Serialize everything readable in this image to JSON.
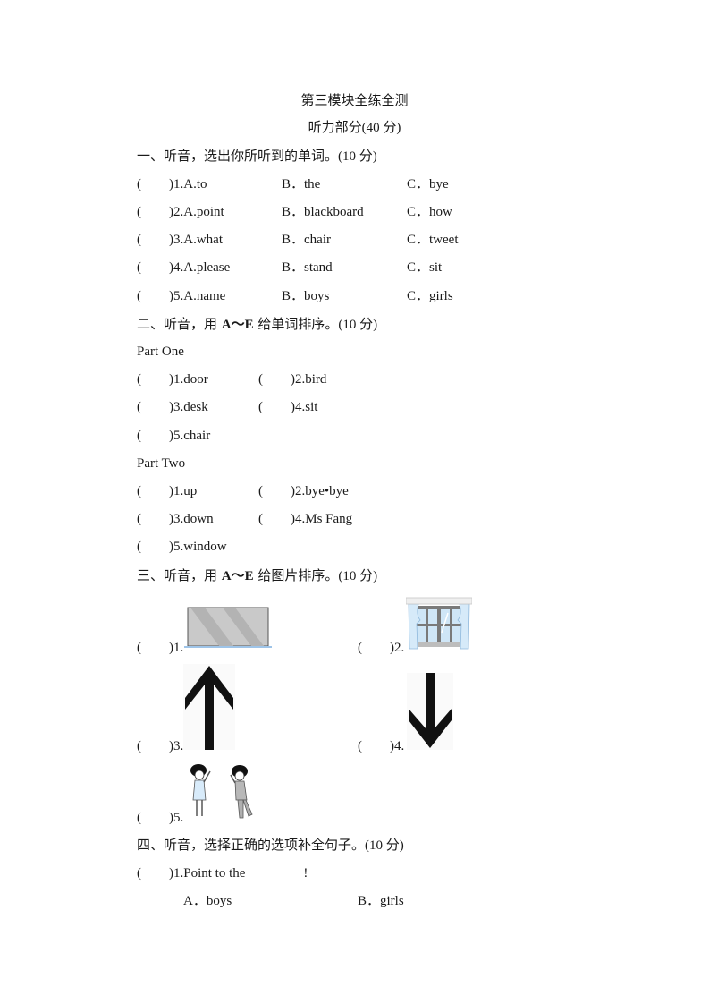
{
  "header": {
    "title": "第三模块全练全测",
    "subtitle": "听力部分(40 分)"
  },
  "section1": {
    "heading": "一、听音，选出你所听到的单词。",
    "score": "(10 分)",
    "questions": [
      {
        "num": ")1.A.to",
        "b": "B．the",
        "c": "C．bye"
      },
      {
        "num": ")2.A.point",
        "b": "B．blackboard",
        "c": "C．how"
      },
      {
        "num": ")3.A.what",
        "b": "B．chair",
        "c": "C．tweet"
      },
      {
        "num": ")4.A.please",
        "b": "B．stand",
        "c": "C．sit"
      },
      {
        "num": ")5.A.name",
        "b": "B．boys",
        "c": "C．girls"
      }
    ]
  },
  "section2": {
    "heading_pre": "二、听音，用 ",
    "heading_bold": "A～E",
    "heading_post": " 给单词排序。",
    "score": "(10 分)",
    "part_one": {
      "label": "Part One",
      "items": [
        ")1.door",
        ")2.bird",
        ")3.desk",
        ")4.sit",
        ")5.chair"
      ]
    },
    "part_two": {
      "label": "Part Two",
      "items": [
        ")1.up",
        ")2.bye•bye",
        ")3.down",
        ")4.Ms Fang",
        ")5.window"
      ]
    }
  },
  "section3": {
    "heading_pre": "三、听音，用 ",
    "heading_bold": "A～E",
    "heading_post": " 给图片排序。",
    "score": "(10 分)",
    "items": [
      {
        "num": ")1.",
        "picture": "blackboard-picture"
      },
      {
        "num": ")2.",
        "picture": "window-picture"
      },
      {
        "num": ")3.",
        "picture": "up-arrow-picture"
      },
      {
        "num": ")4.",
        "picture": "down-arrow-picture"
      },
      {
        "num": ")5.",
        "picture": "bye-bye-picture"
      }
    ]
  },
  "section4": {
    "heading": "四、听音，选择正确的选项补全句子。",
    "score": "(10 分)",
    "questions": [
      {
        "stem": ")1.Point to the",
        "end": "!",
        "a": "A．boys",
        "b": "B．girls"
      }
    ]
  },
  "paren_open": "("
}
